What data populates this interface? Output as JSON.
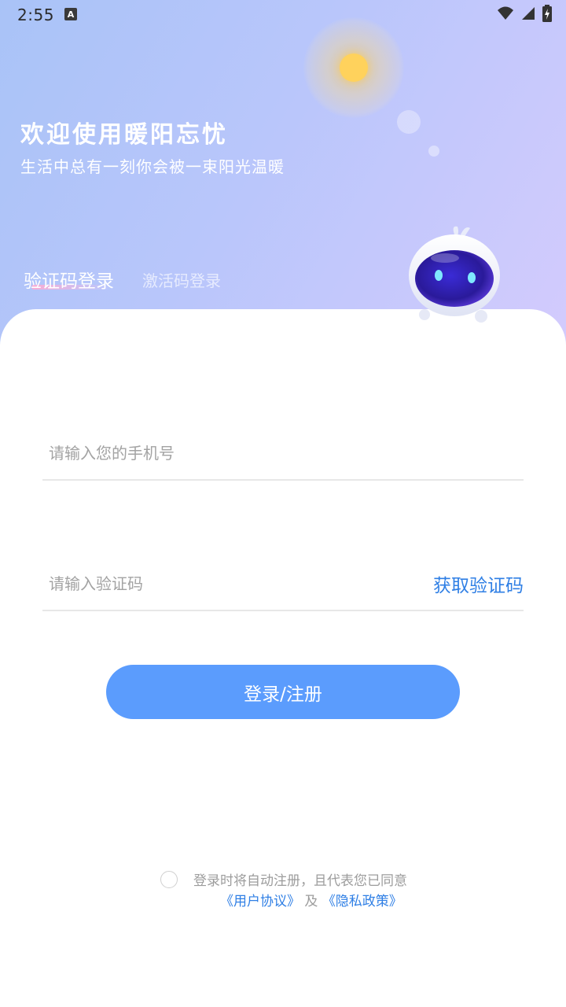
{
  "status_bar": {
    "time": "2:55",
    "notification_icon": "a-notification-icon",
    "icons": [
      "wifi-icon",
      "cell-signal-icon",
      "battery-charging-icon"
    ]
  },
  "hero": {
    "title": "欢迎使用暖阳忘忧",
    "subtitle": "生活中总有一刻你会被一束阳光温暖",
    "tabs": [
      {
        "label": "验证码登录",
        "active": true
      },
      {
        "label": "激活码登录",
        "active": false
      }
    ]
  },
  "form": {
    "phone_placeholder": "请输入您的手机号",
    "code_placeholder": "请输入验证码",
    "get_code_label": "获取验证码",
    "submit_label": "登录/注册"
  },
  "agreement": {
    "text": "登录时将自动注册，且代表您已同意",
    "user_agreement": "《用户协议》",
    "and": "及",
    "privacy_policy": "《隐私政策》",
    "checked": false
  },
  "colors": {
    "accent": "#5b9cfd",
    "link": "#2f7fe5",
    "hero_gradient_start": "#a9c3f7",
    "hero_gradient_end": "#d3cbfd"
  }
}
